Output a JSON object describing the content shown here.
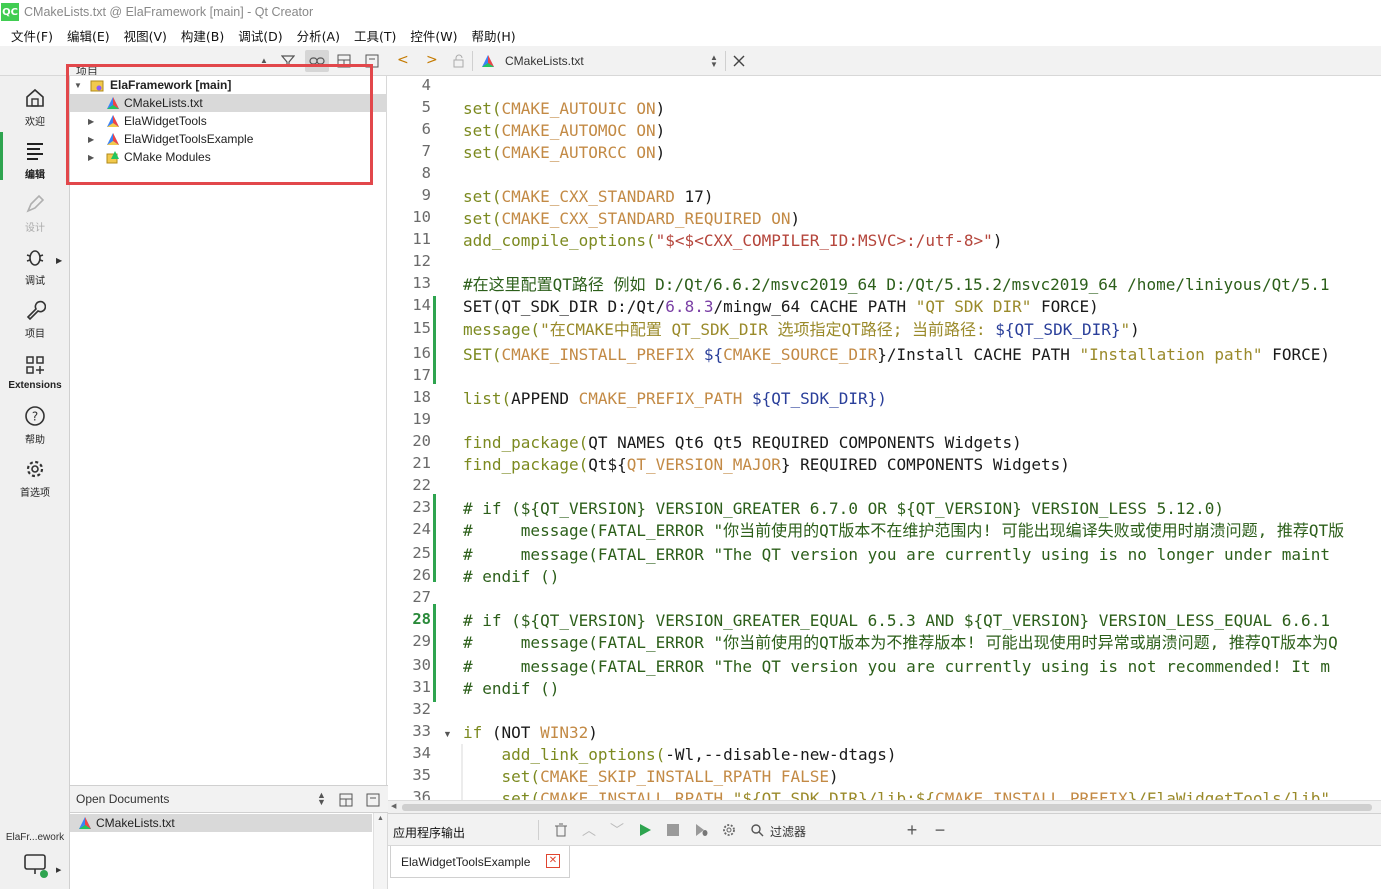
{
  "window": {
    "app_badge": "QC",
    "title": "CMakeLists.txt @ ElaFramework [main] - Qt Creator"
  },
  "menu": [
    "文件(F)",
    "编辑(E)",
    "视图(V)",
    "构建(B)",
    "调试(D)",
    "分析(A)",
    "工具(T)",
    "控件(W)",
    "帮助(H)"
  ],
  "modes": [
    {
      "label": "欢迎",
      "icon": "home-icon",
      "state": "normal"
    },
    {
      "label": "编辑",
      "icon": "edit-icon",
      "state": "active"
    },
    {
      "label": "设计",
      "icon": "design-pen-icon",
      "state": "disabled"
    },
    {
      "label": "调试",
      "icon": "bug-icon",
      "state": "normal"
    },
    {
      "label": "项目",
      "icon": "wrench-icon",
      "state": "normal"
    },
    {
      "label": "Extensions",
      "icon": "extensions-icon",
      "state": "normal"
    },
    {
      "label": "帮助",
      "icon": "help-icon",
      "state": "normal"
    },
    {
      "label": "首选项",
      "icon": "gear-icon",
      "state": "normal"
    }
  ],
  "kit_selector": {
    "label": "ElaFr...ework",
    "icon": "monitor-icon"
  },
  "project_pane": {
    "header_label": "项目",
    "tree": [
      {
        "label": "ElaFramework [main]",
        "icon": "project-icon",
        "expanded": true,
        "bold": true
      },
      {
        "label": "CMakeLists.txt",
        "icon": "cmake-file-icon",
        "selected": true
      },
      {
        "label": "ElaWidgetTools",
        "icon": "cmake-folder-icon",
        "expanded": false
      },
      {
        "label": "ElaWidgetToolsExample",
        "icon": "cmake-folder-icon",
        "expanded": false
      },
      {
        "label": "CMake Modules",
        "icon": "modules-icon",
        "expanded": false
      }
    ]
  },
  "open_documents": {
    "header_label": "Open Documents",
    "items": [
      "CMakeLists.txt"
    ]
  },
  "editor": {
    "current_document": "CMakeLists.txt",
    "current_line": 28,
    "lines": [
      {
        "n": "4"
      },
      {
        "n": "5"
      },
      {
        "n": "6"
      },
      {
        "n": "7"
      },
      {
        "n": "8"
      },
      {
        "n": "9"
      },
      {
        "n": "10"
      },
      {
        "n": "11"
      },
      {
        "n": "12"
      },
      {
        "n": "13"
      },
      {
        "n": "14"
      },
      {
        "n": "15"
      },
      {
        "n": "16"
      },
      {
        "n": "17"
      },
      {
        "n": "18"
      },
      {
        "n": "19"
      },
      {
        "n": "20"
      },
      {
        "n": "21"
      },
      {
        "n": "22"
      },
      {
        "n": "23"
      },
      {
        "n": "24"
      },
      {
        "n": "25"
      },
      {
        "n": "26"
      },
      {
        "n": "27"
      },
      {
        "n": "28"
      },
      {
        "n": "29"
      },
      {
        "n": "30"
      },
      {
        "n": "31"
      },
      {
        "n": "32"
      },
      {
        "n": "33"
      },
      {
        "n": "34"
      },
      {
        "n": "35"
      },
      {
        "n": "36"
      }
    ],
    "code": {
      "l5": [
        "set(",
        "CMAKE_AUTOUIC ON",
        ")"
      ],
      "l6": [
        "set(",
        "CMAKE_AUTOMOC ON",
        ")"
      ],
      "l7": [
        "set(",
        "CMAKE_AUTORCC ON",
        ")"
      ],
      "l9": [
        "set(",
        "CMAKE_CXX_STANDARD",
        " 17)"
      ],
      "l10": [
        "set(",
        "CMAKE_CXX_STANDARD_REQUIRED ON",
        ")"
      ],
      "l11": [
        "add_compile_options(",
        "\"$<$<CXX_COMPILER_ID:MSVC>:/utf-8>\"",
        ")"
      ],
      "l13": "#在这里配置QT路径 例如 D:/Qt/6.6.2/msvc2019_64 D:/Qt/5.15.2/msvc2019_64 /home/liniyous/Qt/5.1",
      "l14": [
        "SET(QT_SDK_DIR D:/Qt/",
        "6.8.3",
        "/mingw_64 CACHE PATH ",
        "\"QT SDK DIR\"",
        " FORCE)"
      ],
      "l15": [
        "message(",
        "\"在CMAKE中配置 QT_SDK_DIR 选项指定QT路径; 当前路径: ",
        "${QT_SDK_DIR}",
        "\"",
        ")"
      ],
      "l16": [
        "SET(",
        "CMAKE_INSTALL_PREFIX",
        " ${",
        "CMAKE_SOURCE_DIR",
        "}/Install CACHE PATH ",
        "\"Installation path\"",
        " FORCE)"
      ],
      "l18": [
        "list(",
        "APPEND ",
        "CMAKE_PREFIX_PATH",
        " ${QT_SDK_DIR})"
      ],
      "l20": [
        "find_package(",
        "QT NAMES Qt6 Qt5 REQUIRED COMPONENTS Widgets)"
      ],
      "l21": [
        "find_package(",
        "Qt${",
        "QT_VERSION_MAJOR",
        "} REQUIRED COMPONENTS Widgets)"
      ],
      "l23": "# if (${QT_VERSION} VERSION_GREATER 6.7.0 OR ${QT_VERSION} VERSION_LESS 5.12.0)",
      "l24": "#     message(FATAL_ERROR \"你当前使用的QT版本不在维护范围内! 可能出现编译失败或使用时崩溃问题, 推荐QT版",
      "l25": "#     message(FATAL_ERROR \"The QT version you are currently using is no longer under maint",
      "l26": "# endif ()",
      "l28": "# if (${QT_VERSION} VERSION_GREATER_EQUAL 6.5.3 AND ${QT_VERSION} VERSION_LESS_EQUAL 6.6.1",
      "l29": "#     message(FATAL_ERROR \"你当前使用的QT版本为不推荐版本! 可能出现使用时异常或崩溃问题, 推荐QT版本为Q",
      "l30": "#     message(FATAL_ERROR \"The QT version you are currently using is not recommended! It m",
      "l31": "# endif ()",
      "l33": [
        "if",
        " (NOT ",
        "WIN32",
        ")"
      ],
      "l34": [
        "    add_link_options(",
        "-Wl,--disable-new-dtags)"
      ],
      "l35": [
        "    set(",
        "CMAKE_SKIP_INSTALL_RPATH FALSE",
        ")"
      ],
      "l36": [
        "    set(",
        "CMAKE_INSTALL_RPATH",
        " \"${QT_SDK_DIR}/lib:${",
        "CMAKE_INSTALL_PREFIX",
        "}/ElaWidgetTools/lib\""
      ]
    }
  },
  "output_pane": {
    "title": "应用程序输出",
    "filter_placeholder": "过滤器",
    "tabs": [
      {
        "label": "ElaWidgetToolsExample"
      }
    ]
  },
  "colors": {
    "accent_green": "#2ea44f",
    "highlight_red": "#e2474b",
    "keyword": "#7c8a20",
    "variable": "#c38a45",
    "comment": "#2c5f1a"
  }
}
